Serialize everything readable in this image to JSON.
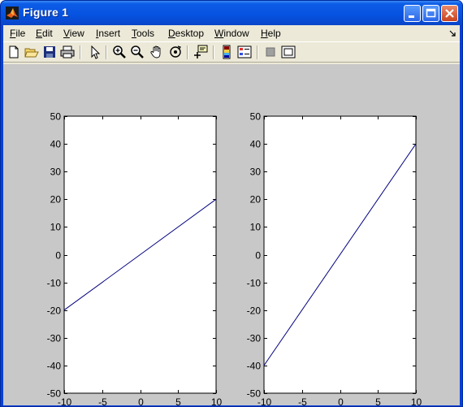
{
  "window": {
    "title": "Figure 1",
    "colors": {
      "titlebar": "#0552e0",
      "client": "#ece9d8",
      "figure_bg": "#c8c8c8",
      "line": "#00007f"
    }
  },
  "menubar": {
    "items": [
      {
        "accel": "F",
        "rest": "ile"
      },
      {
        "accel": "E",
        "rest": "dit"
      },
      {
        "accel": "V",
        "rest": "iew"
      },
      {
        "accel": "I",
        "rest": "nsert"
      },
      {
        "accel": "T",
        "rest": "ools"
      },
      {
        "accel": "D",
        "rest": "esktop"
      },
      {
        "accel": "W",
        "rest": "indow"
      },
      {
        "accel": "H",
        "rest": "elp"
      }
    ]
  },
  "toolbar": {
    "icons": [
      "new-figure-icon",
      "open-file-icon",
      "save-icon",
      "print-icon",
      "edit-plot-arrow-icon",
      "zoom-in-icon",
      "zoom-out-icon",
      "pan-hand-icon",
      "rotate-3d-icon",
      "data-cursor-icon",
      "insert-colorbar-icon",
      "insert-legend-icon",
      "hide-plot-tools-icon",
      "show-plot-tools-icon"
    ]
  },
  "chart_data": [
    {
      "type": "line",
      "title": "",
      "xlabel": "",
      "ylabel": "",
      "xlim": [
        -10,
        10
      ],
      "ylim": [
        -50,
        50
      ],
      "xticks": [
        -10,
        -5,
        0,
        5,
        10
      ],
      "yticks": [
        -50,
        -40,
        -30,
        -20,
        -10,
        0,
        10,
        20,
        30,
        40,
        50
      ],
      "grid": false,
      "series": [
        {
          "x": [
            -10,
            10
          ],
          "y": [
            -20,
            20
          ],
          "color": "#00007f"
        }
      ]
    },
    {
      "type": "line",
      "title": "",
      "xlabel": "",
      "ylabel": "",
      "xlim": [
        -10,
        10
      ],
      "ylim": [
        -50,
        50
      ],
      "xticks": [
        -10,
        -5,
        0,
        5,
        10
      ],
      "yticks": [
        -50,
        -40,
        -30,
        -20,
        -10,
        0,
        10,
        20,
        30,
        40,
        50
      ],
      "grid": false,
      "series": [
        {
          "x": [
            -10,
            10
          ],
          "y": [
            -40,
            40
          ],
          "color": "#00007f"
        }
      ]
    }
  ]
}
